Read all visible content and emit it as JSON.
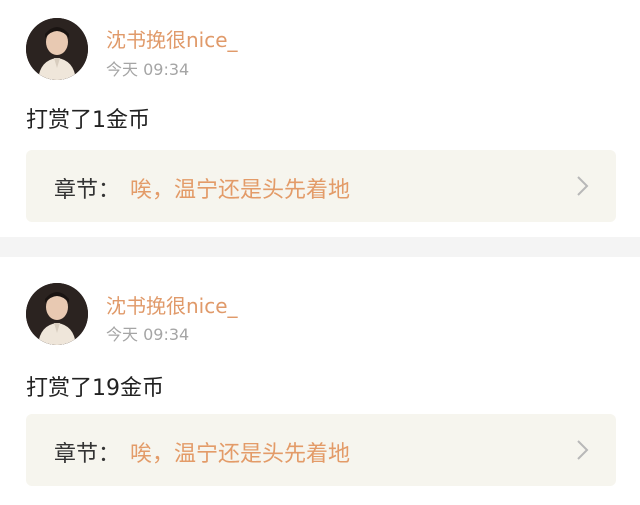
{
  "items": [
    {
      "username": "沈书挽很nice_",
      "time": "今天 09:34",
      "reward_text": "打赏了1金币",
      "chapter_prefix": "章节：",
      "chapter_title": "唉，温宁还是头先着地"
    },
    {
      "username": "沈书挽很nice_",
      "time": "今天 09:34",
      "reward_text": "打赏了19金币",
      "chapter_prefix": "章节：",
      "chapter_title": "唉，温宁还是头先着地"
    }
  ],
  "colors": {
    "username": "#e09a6a",
    "chapter_title": "#e39b68",
    "chapter_bg": "#f6f5ee",
    "divider": "#f4f4f4"
  },
  "icons": [
    "avatar",
    "chevron-right-icon"
  ]
}
